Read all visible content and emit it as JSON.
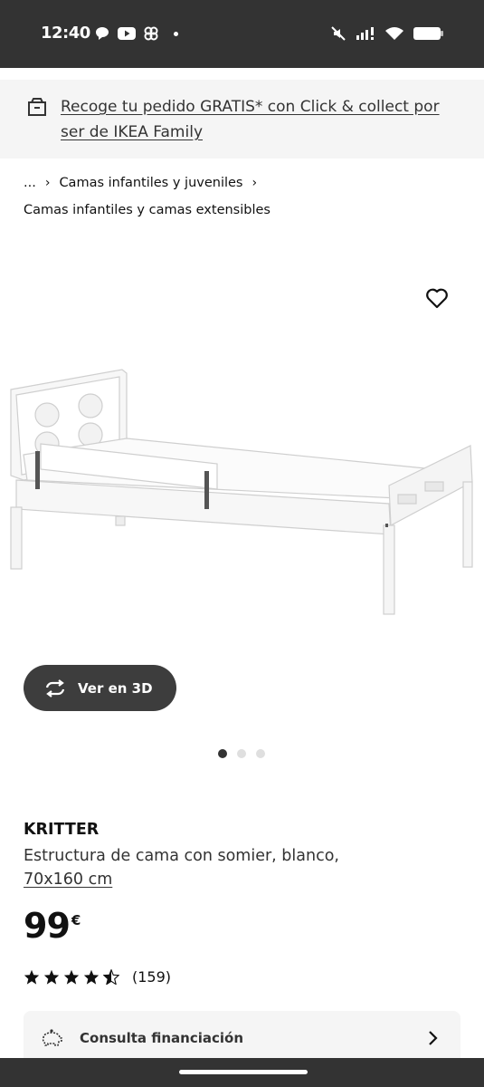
{
  "status_bar": {
    "time": "12:40",
    "left_icons": [
      "chat-bubble-icon",
      "youtube-icon",
      "pinwheel-icon"
    ],
    "right_icons": [
      "mute-icon",
      "signal-icon",
      "wifi-icon",
      "battery-icon"
    ]
  },
  "promo": {
    "icon": "store-box-icon",
    "text": "Recoge tu pedido GRATIS* con Click & collect por ser de IKEA Family"
  },
  "breadcrumb": {
    "ellipsis": "...",
    "parent": "Camas infantiles y juveniles",
    "current": "Camas infantiles y camas extensibles"
  },
  "gallery": {
    "favorite_icon": "heart-outline-icon",
    "view3d_label": "Ver en 3D",
    "view3d_icon": "rotate-icon",
    "dots_total": 3,
    "dots_active": 1
  },
  "product": {
    "name": "KRITTER",
    "description": "Estructura de cama con somier, blanco,",
    "size": "70x160 cm",
    "price": "99",
    "currency": "€",
    "rating": 4.5,
    "rating_count": "(159)"
  },
  "finance": {
    "icon": "piggy-bank-icon",
    "label": "Consulta financiación",
    "chevron_icon": "chevron-right-icon"
  },
  "colors": {
    "status_bar": "#333333",
    "promo_bg": "#f5f5f5",
    "button_dark": "#3d3d3d",
    "text": "#111111"
  }
}
